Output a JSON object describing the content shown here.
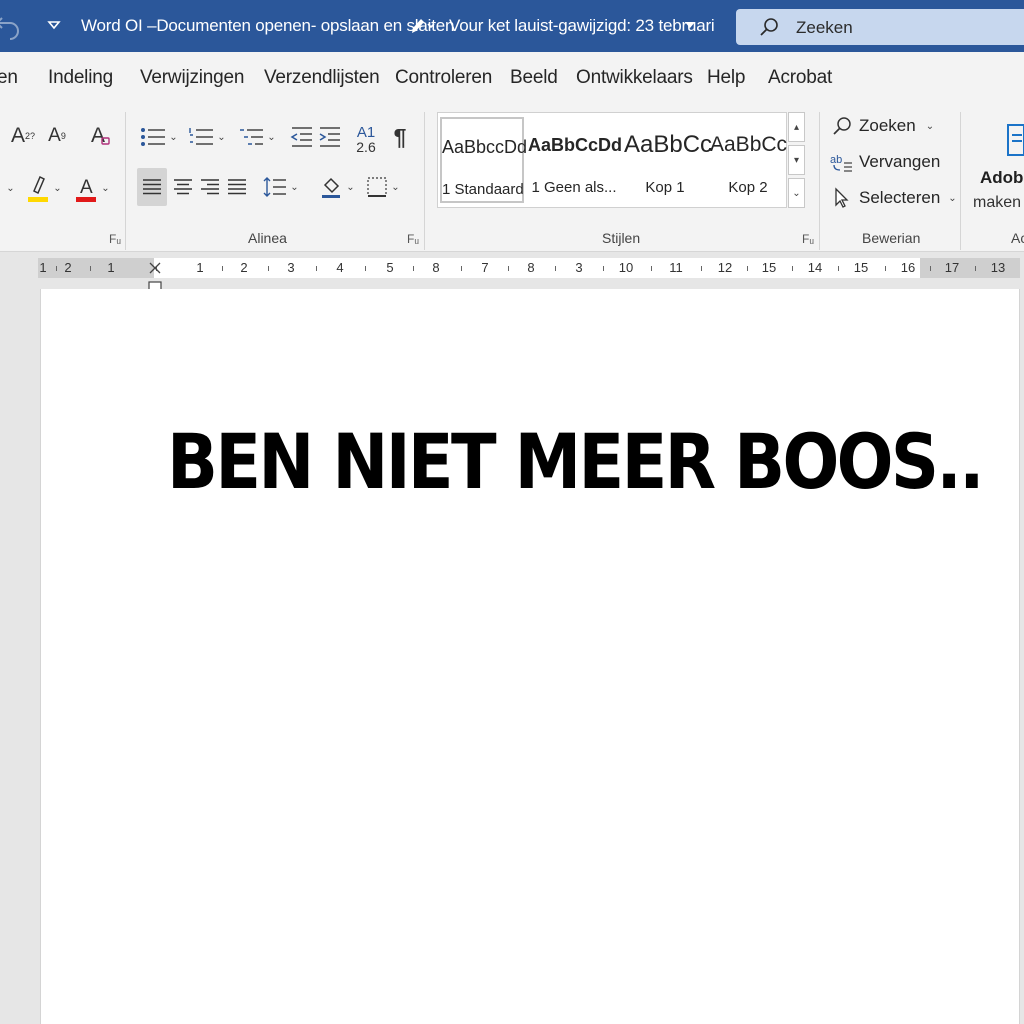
{
  "titlebar": {
    "doc_title": "Word OI –Documenten openen- opslaan en slaiten",
    "modified": "Vour ket lauist-gawijzigd: 23 tebruari",
    "search_placeholder": "Zeeken"
  },
  "menu": {
    "tabs": [
      "en",
      "Indeling",
      "Verwijzingen",
      "Verzendlijsten",
      "Controleren",
      "Beeld",
      "Ontwikkelaars",
      "Help",
      "Acrobat"
    ]
  },
  "ribbon": {
    "font": {
      "grow": "A",
      "grow_sup": "2?",
      "shrink": "A",
      "shrink_sup": "9",
      "clear": "A",
      "color_letter": "A"
    },
    "paragraph": {
      "label": "Alinea",
      "sort_top": "A1",
      "sort_bottom": "2.6",
      "pilcrow": "¶"
    },
    "styles": {
      "label": "Stijlen",
      "items": [
        {
          "preview": "AaBbccDd",
          "name": "1 Standaard"
        },
        {
          "preview": "AaBbCcDd",
          "name": "1 Geen als..."
        },
        {
          "preview": "AaBbCc",
          "name": "Kop 1"
        },
        {
          "preview": "AaBbCc",
          "name": "Kop 2"
        }
      ]
    },
    "editing": {
      "label": "Bewerian",
      "find": "Zoeken",
      "replace": "Vervangen",
      "select": "Selecteren"
    },
    "adobe": {
      "title": "Adobe",
      "sub": "maken e",
      "group_label": "Ac"
    },
    "launcher_glyph": "Fᵤ"
  },
  "ruler": {
    "labels": [
      "1",
      "2",
      "1",
      "1",
      "2",
      "3",
      "4",
      "5",
      "8",
      "7",
      "8",
      "3",
      "10",
      "11",
      "12",
      "15",
      "14",
      "15",
      "16",
      "17",
      "13"
    ]
  },
  "document": {
    "text": "BEN NIET MEER BOOS.."
  },
  "colors": {
    "titlebar": "#2b579a",
    "highlight": "#ffd800",
    "font_color": "#e11919",
    "adobe_blue": "#1a73c8"
  }
}
